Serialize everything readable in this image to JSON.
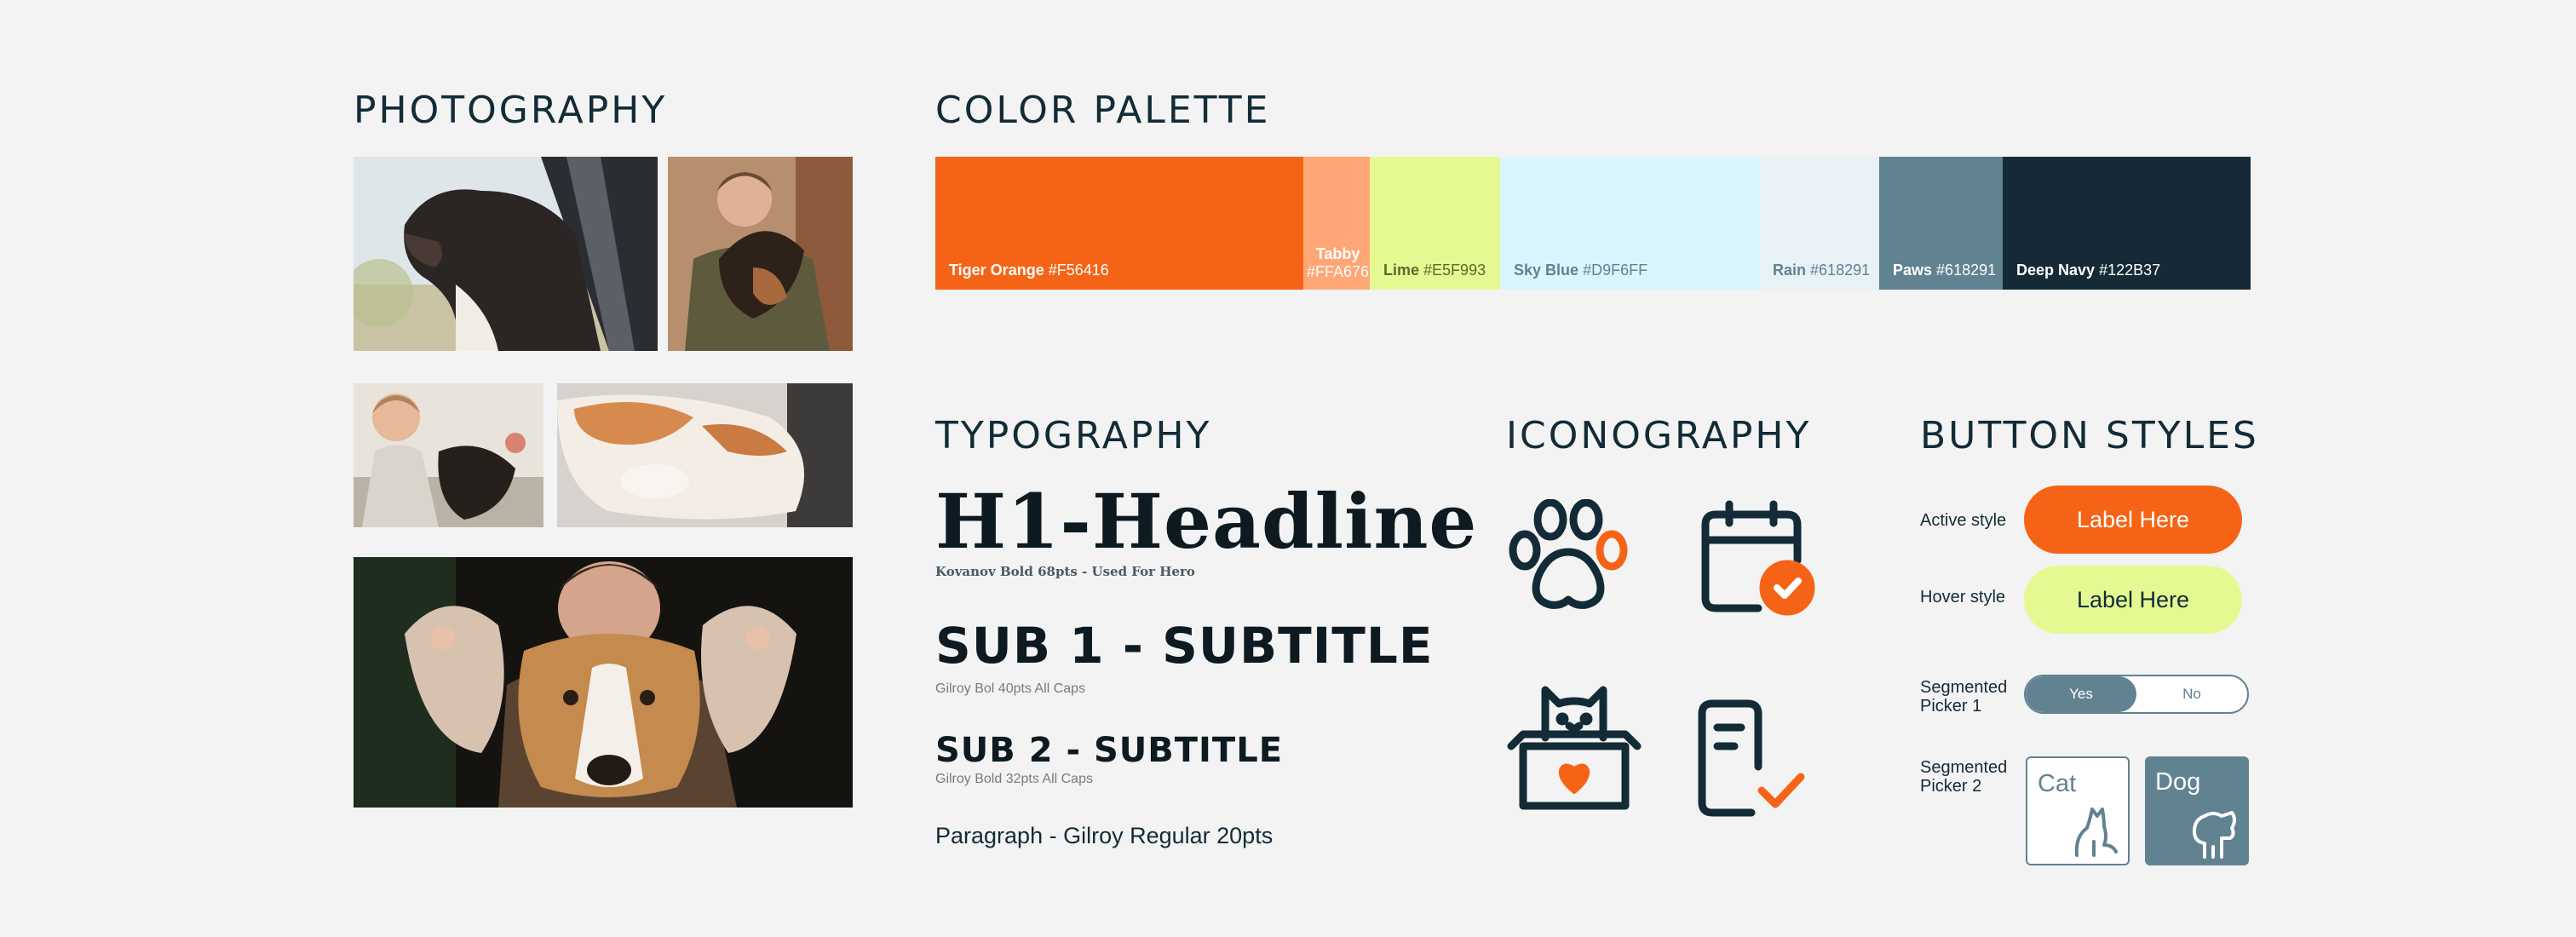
{
  "sections": {
    "photography": "PHOTOGRAPHY",
    "color_palette": "COLOR PALETTE",
    "typography": "TYPOGRAPHY",
    "iconography": "ICONOGRAPHY",
    "button_styles": "BUTTON STYLES"
  },
  "palette": [
    {
      "name": "Tiger Orange",
      "hex": "#F56416",
      "color": "#F56416",
      "text_color": "#ffffff"
    },
    {
      "name": "Tabby",
      "hex": "#FFA676",
      "color": "#FFA676",
      "text_color": "#ffffff"
    },
    {
      "name": "Lime",
      "hex": "#E5F993",
      "color": "#E5F993",
      "text_color": "#5a6b2a"
    },
    {
      "name": "Sky Blue",
      "hex": "#D9F6FF",
      "color": "#D9F6FF",
      "text_color": "#618291"
    },
    {
      "name": "Rain",
      "hex": "#618291",
      "color": "#E8F1F6",
      "text_color": "#618291"
    },
    {
      "name": "Paws",
      "hex": "#618291",
      "color": "#618291",
      "text_color": "#ffffff"
    },
    {
      "name": "Deep Navy",
      "hex": "#122B37",
      "color": "#152A36",
      "text_color": "#ffffff"
    }
  ],
  "typography": {
    "h1": "H1-Headline",
    "h1_note": "Kovanov Bold 68pts - Used For Hero",
    "sub1": "SUB 1  - SUBTITLE",
    "sub1_note": "Gilroy Bol 40pts All Caps",
    "sub2": "SUB 2  - SUBTITLE",
    "sub2_note": "Gilroy Bold 32pts All Caps",
    "paragraph": "Paragraph  - Gilroy Regular 20pts"
  },
  "icons": [
    "paw-icon",
    "calendar-check-icon",
    "cat-adoption-box-icon",
    "document-check-icon"
  ],
  "buttons": {
    "active_label": "Active style",
    "active_button": "Label Here",
    "hover_label": "Hover style",
    "hover_button": "Label Here",
    "seg1_label": "Segmented Picker 1",
    "seg1_yes": "Yes",
    "seg1_no": "No",
    "seg2_label": "Segmented Picker 2",
    "seg2_cat": "Cat",
    "seg2_dog": "Dog"
  },
  "colors": {
    "accent": "#F56416",
    "navy": "#122B37",
    "slate": "#618291",
    "lime": "#E5F993"
  }
}
